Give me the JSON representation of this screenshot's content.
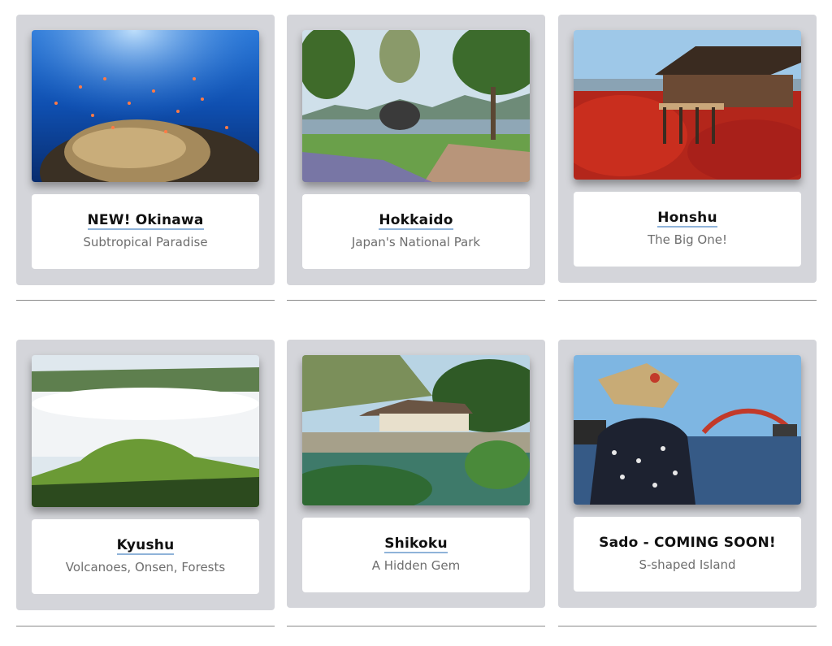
{
  "destinations": [
    {
      "title": "NEW! Okinawa",
      "subtitle": "Subtropical Paradise"
    },
    {
      "title": "Hokkaido",
      "subtitle": "Japan's National Park"
    },
    {
      "title": "Honshu",
      "subtitle": "The Big One!"
    },
    {
      "title": "Kyushu",
      "subtitle": "Volcanoes, Onsen, Forests"
    },
    {
      "title": "Shikoku",
      "subtitle": "A Hidden Gem"
    },
    {
      "title": "Sado - COMING SOON!",
      "subtitle": "S-shaped Island"
    }
  ],
  "colors": {
    "card_bg": "#d4d5da",
    "link_underline": "#8fb3d9",
    "divider": "#8a8a8a"
  }
}
